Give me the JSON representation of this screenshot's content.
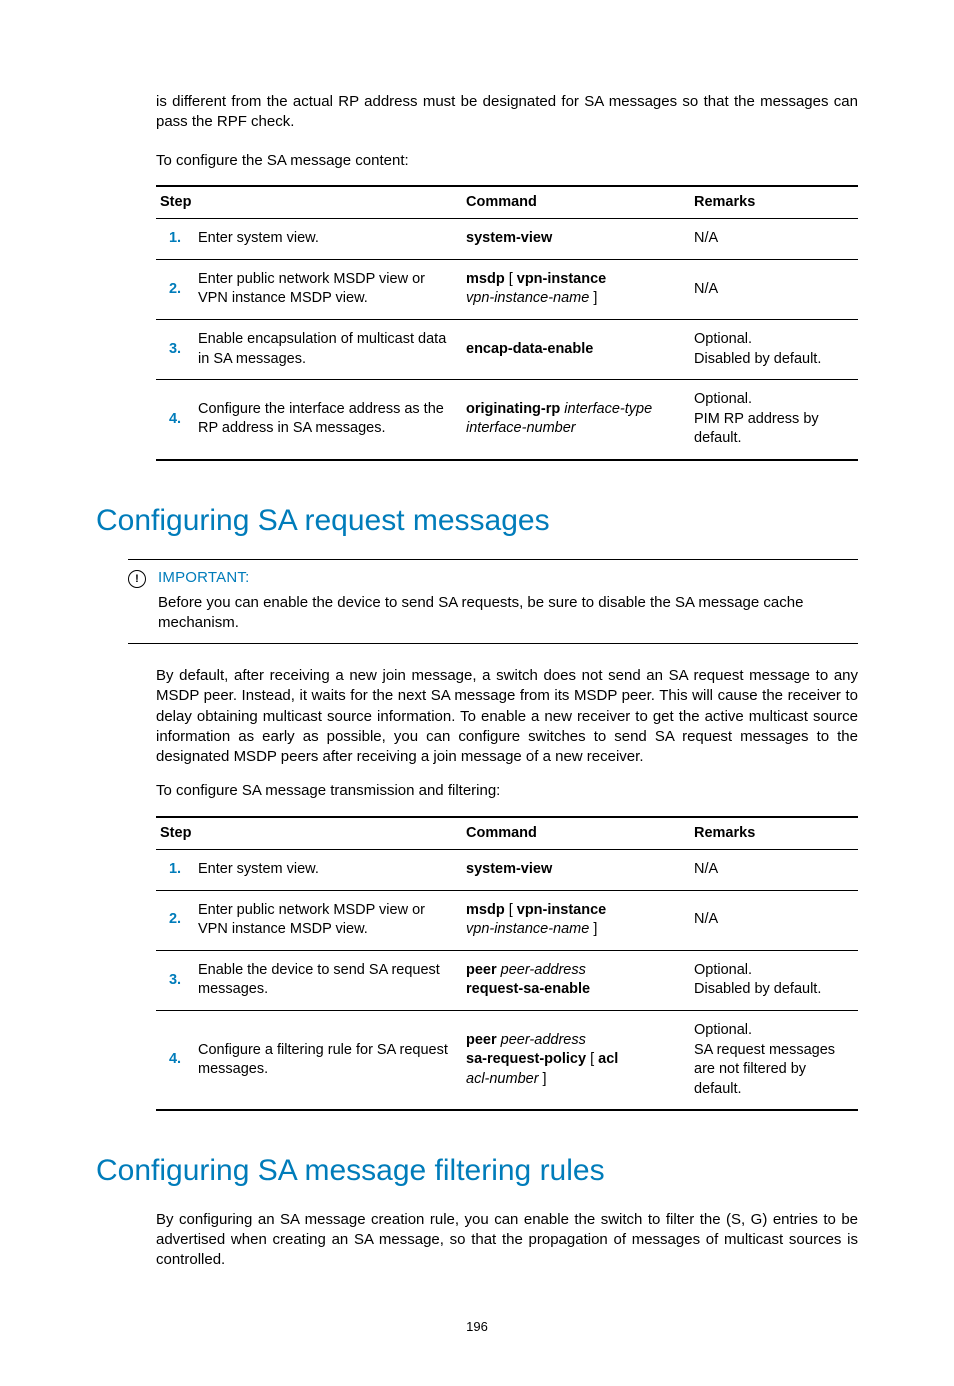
{
  "intro": {
    "para1": "is different from the actual RP address must be designated for SA messages so that the messages can pass the RPF check.",
    "para2": "To configure the SA message content:"
  },
  "table1": {
    "headers": {
      "step": "Step",
      "command": "Command",
      "remarks": "Remarks"
    },
    "rows": [
      {
        "num": "1.",
        "step": "Enter system view.",
        "cmd_bold": "system-view",
        "cmd_ital": "",
        "remarks": [
          "N/A"
        ]
      },
      {
        "num": "2.",
        "step": "Enter public network MSDP view or VPN instance MSDP view.",
        "cmd_bold": "msdp",
        "cmd_mid": " [ ",
        "cmd_bold2": "vpn-instance",
        "cmd_ital": "vpn-instance-name",
        "cmd_end": " ]",
        "remarks": [
          "N/A"
        ]
      },
      {
        "num": "3.",
        "step": "Enable encapsulation of multicast data in SA messages.",
        "cmd_bold": "encap-data-enable",
        "cmd_ital": "",
        "remarks": [
          "Optional.",
          "Disabled by default."
        ]
      },
      {
        "num": "4.",
        "step": "Configure the interface address as the RP address in SA messages.",
        "cmd_bold": "originating-rp",
        "cmd_ital": " interface-type interface-number",
        "remarks": [
          "Optional.",
          "PIM RP address by default."
        ]
      }
    ]
  },
  "section1": {
    "title": "Configuring SA request messages",
    "important_label": "IMPORTANT:",
    "important_body": "Before you can enable the device to send SA requests, be sure to disable the SA message cache mechanism.",
    "para1": "By default, after receiving a new join message, a switch does not send an SA request message to any MSDP peer. Instead, it waits for the next SA message from its MSDP peer. This will cause the receiver to delay obtaining multicast source information. To enable a new receiver to get the active multicast source information as early as possible, you can configure switches to send SA request messages to the designated MSDP peers after receiving a join message of a new receiver.",
    "para2": "To configure SA message transmission and filtering:"
  },
  "table2": {
    "headers": {
      "step": "Step",
      "command": "Command",
      "remarks": "Remarks"
    },
    "rows": [
      {
        "num": "1.",
        "step": "Enter system view.",
        "cmd_html": "<span class=\"bold\">system-view</span>",
        "remarks": [
          "N/A"
        ]
      },
      {
        "num": "2.",
        "step": "Enter public network MSDP view or VPN instance MSDP view.",
        "cmd_html": "<span class=\"bold\">msdp</span> [ <span class=\"bold\">vpn-instance</span><br><span class=\"ital\">vpn-instance-name</span> ]",
        "remarks": [
          "N/A"
        ]
      },
      {
        "num": "3.",
        "step": "Enable the device to send SA request messages.",
        "cmd_html": "<span class=\"bold\">peer</span> <span class=\"ital\">peer-address</span><br><span class=\"bold\">request-sa-enable</span>",
        "remarks": [
          "Optional.",
          "Disabled by default."
        ]
      },
      {
        "num": "4.",
        "step": "Configure a filtering rule for SA request messages.",
        "cmd_html": "<span class=\"bold\">peer</span> <span class=\"ital\">peer-address</span><br><span class=\"bold\">sa-request-policy</span> [ <span class=\"bold\">acl</span><br><span class=\"ital\">acl-number</span> ]",
        "remarks": [
          "Optional.",
          "SA request messages are not filtered by default."
        ]
      }
    ]
  },
  "section2": {
    "title": "Configuring SA message filtering rules",
    "para1": "By configuring an SA message creation rule, you can enable the switch to filter the (S, G) entries to be advertised when creating an SA message, so that the propagation of messages of multicast sources is controlled."
  },
  "page_number": "196"
}
